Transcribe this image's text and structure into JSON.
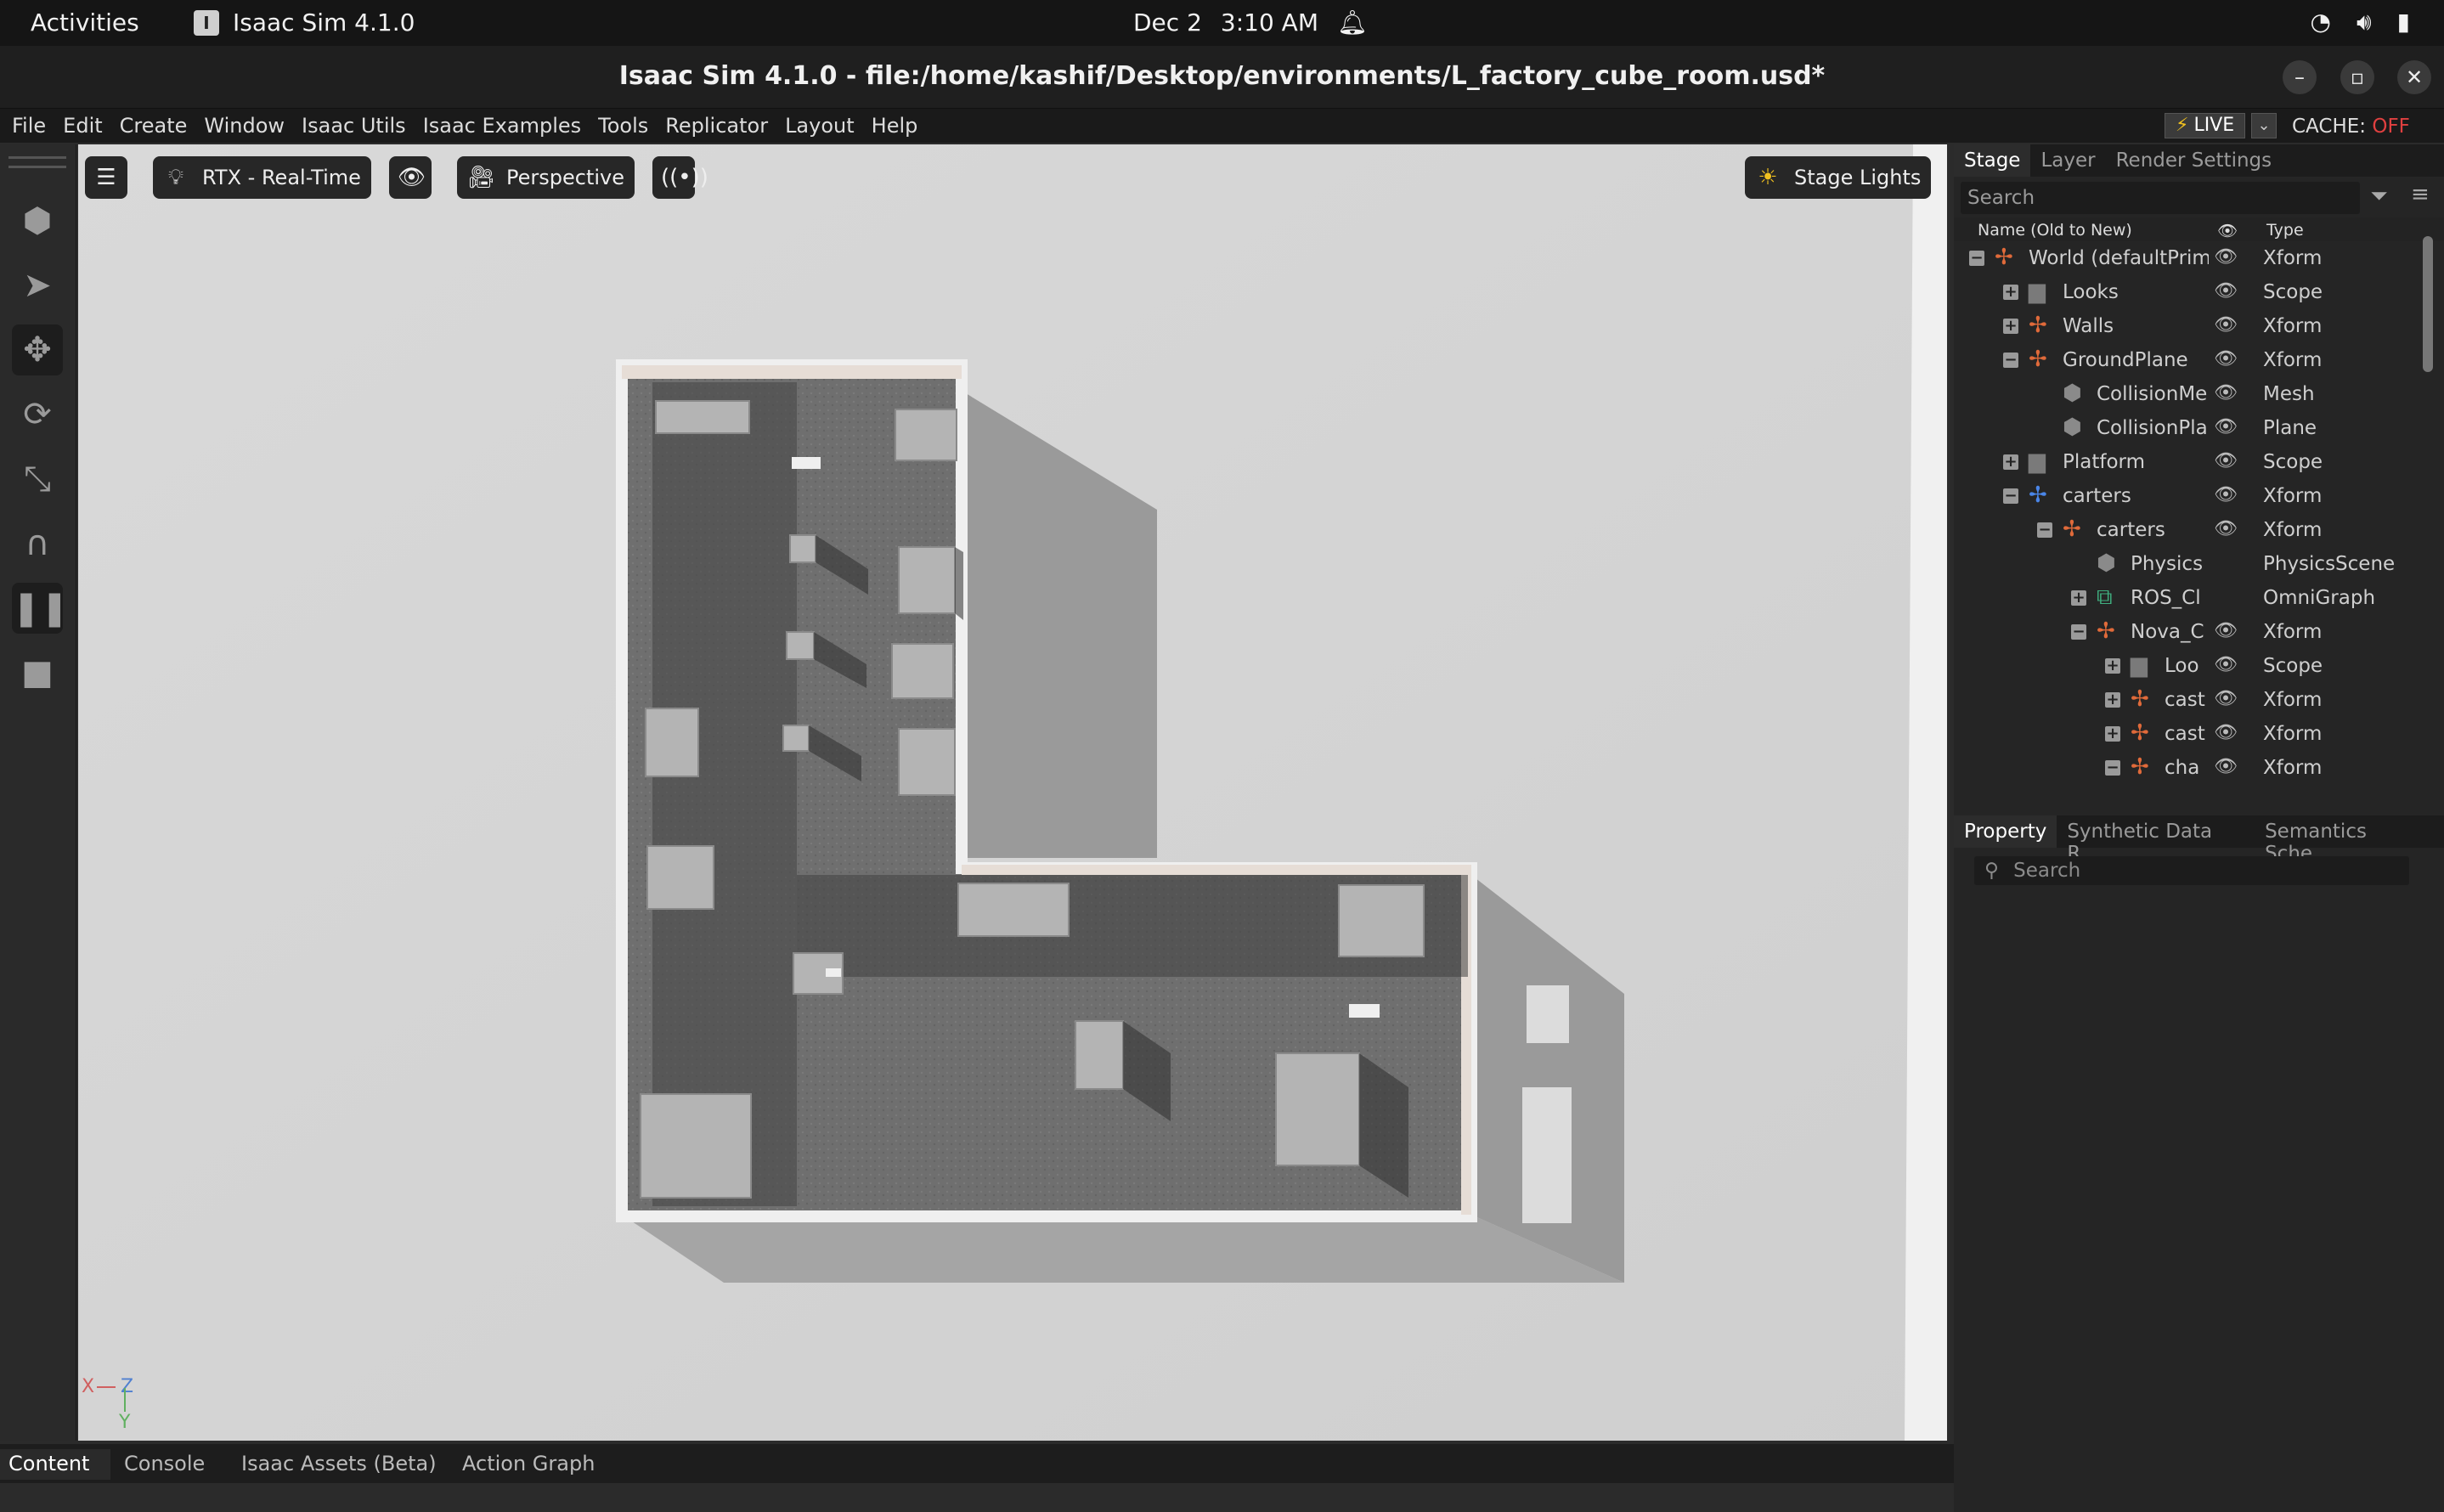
{
  "os_bar": {
    "activities": "Activities",
    "app_name": "Isaac Sim 4.1.0",
    "date": "Dec 2",
    "time": "3:10 AM"
  },
  "window": {
    "title": "Isaac Sim 4.1.0 - file:/home/kashif/Desktop/environments/L_factory_cube_room.usd*"
  },
  "menu": [
    "File",
    "Edit",
    "Create",
    "Window",
    "Isaac Utils",
    "Isaac Examples",
    "Tools",
    "Replicator",
    "Layout",
    "Help"
  ],
  "live": {
    "label": "LIVE",
    "cache_label": "CACHE:",
    "cache_state": "OFF"
  },
  "viewport": {
    "renderer": "RTX - Real-Time",
    "camera": "Perspective",
    "stage_lights": "Stage Lights",
    "axis_x": "X",
    "axis_z": "Z",
    "axis_y": "Y"
  },
  "stage": {
    "tabs": [
      "Stage",
      "Layer",
      "Render Settings"
    ],
    "search_placeholder": "Search",
    "col_name": "Name (Old to New)",
    "col_type": "Type",
    "rows": [
      {
        "name": "World (defaultPrim",
        "type": "Xform",
        "exp": "-",
        "icon": "xform",
        "eye": true
      },
      {
        "name": "Looks",
        "type": "Scope",
        "exp": "+",
        "icon": "folder",
        "eye": true
      },
      {
        "name": "Walls",
        "type": "Xform",
        "exp": "+",
        "icon": "xform",
        "eye": true
      },
      {
        "name": "GroundPlane",
        "type": "Xform",
        "exp": "-",
        "icon": "xform",
        "eye": true
      },
      {
        "name": "CollisionMe",
        "type": "Mesh",
        "exp": "",
        "icon": "mesh",
        "eye": true
      },
      {
        "name": "CollisionPla",
        "type": "Plane",
        "exp": "",
        "icon": "mesh",
        "eye": true
      },
      {
        "name": "Platform",
        "type": "Scope",
        "exp": "+",
        "icon": "folder",
        "eye": true
      },
      {
        "name": "carters",
        "type": "Xform",
        "exp": "-",
        "icon": "robot",
        "eye": true
      },
      {
        "name": "carters",
        "type": "Xform",
        "exp": "-",
        "icon": "xform",
        "eye": true
      },
      {
        "name": "Physics",
        "type": "PhysicsScene",
        "exp": "",
        "icon": "mesh",
        "eye": false
      },
      {
        "name": "ROS_Cl",
        "type": "OmniGraph",
        "exp": "+",
        "icon": "graph",
        "eye": false
      },
      {
        "name": "Nova_C",
        "type": "Xform",
        "exp": "-",
        "icon": "xform",
        "eye": true
      },
      {
        "name": "Loo",
        "type": "Scope",
        "exp": "+",
        "icon": "folder",
        "eye": true
      },
      {
        "name": "cast",
        "type": "Xform",
        "exp": "+",
        "icon": "xform",
        "eye": true
      },
      {
        "name": "cast",
        "type": "Xform",
        "exp": "+",
        "icon": "xform",
        "eye": true
      },
      {
        "name": "cha",
        "type": "Xform",
        "exp": "-",
        "icon": "xform",
        "eye": true
      }
    ]
  },
  "property": {
    "tabs": [
      "Property",
      "Synthetic Data R...",
      "Semantics Sche..."
    ],
    "search_placeholder": "Search"
  },
  "bottom_tabs": [
    "Content",
    "Console",
    "Isaac Assets (Beta)",
    "Action Graph"
  ]
}
